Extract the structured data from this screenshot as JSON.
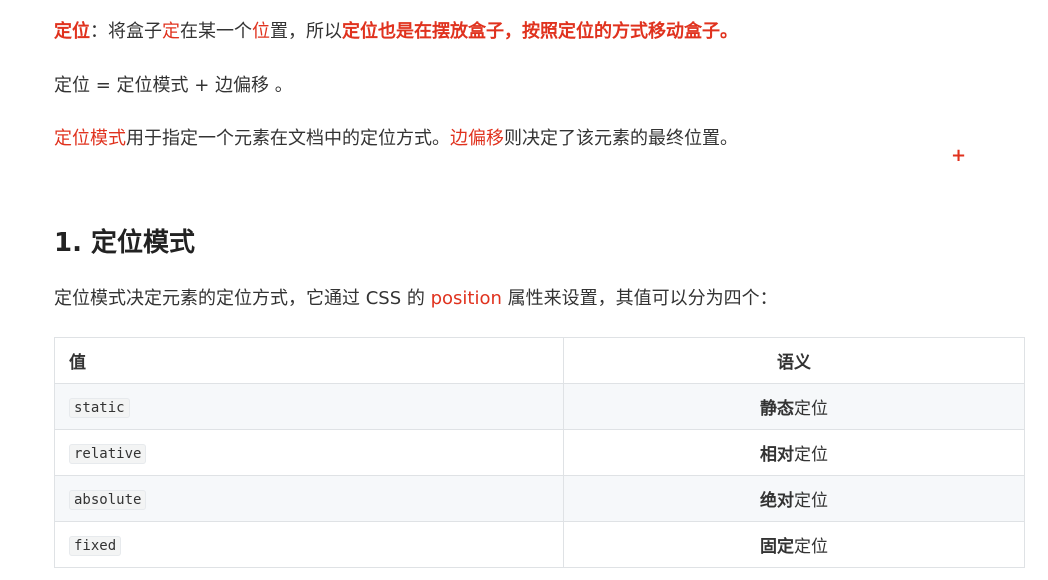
{
  "para1": {
    "w1": "定位",
    "w2": "：将盒子",
    "w3": "定",
    "w4": "在某一个",
    "w5": "位",
    "w6": "置，所以",
    "w7": "定位也是在摆放盒子，按照定位的方式移动盒子。"
  },
  "para2": {
    "text": "定位 = 定位模式 + 边偏移 。"
  },
  "para3": {
    "w1": "定位模式",
    "w2": "用于指定一个元素在文档中的定位方式。",
    "w3": "边偏移",
    "w4": "则决定了该元素的最终位置。"
  },
  "cursor": "+",
  "heading": {
    "text": "1. 定位模式"
  },
  "para4": {
    "w1": "定位模式决定元素的定位方式，它通过 CSS 的 ",
    "w2": "position",
    "w3": " 属性来设置，其值可以分为四个："
  },
  "table": {
    "headers": [
      "值",
      "语义"
    ],
    "rows": [
      {
        "value": "static",
        "bold": "静态",
        "rest": "定位"
      },
      {
        "value": "relative",
        "bold": "相对",
        "rest": "定位"
      },
      {
        "value": "absolute",
        "bold": "绝对",
        "rest": "定位"
      },
      {
        "value": "fixed",
        "bold": "固定",
        "rest": "定位"
      }
    ]
  },
  "colors": {
    "accent": "#e0321e",
    "border": "#dfe2e5",
    "stripe": "#f6f8fa"
  }
}
